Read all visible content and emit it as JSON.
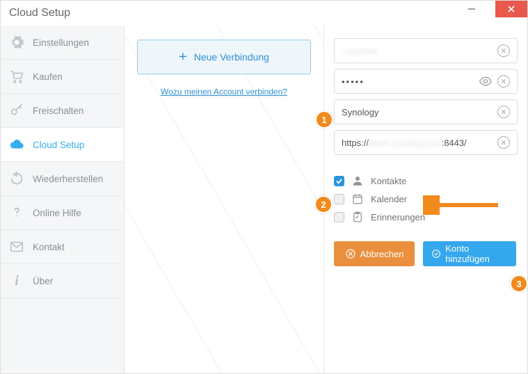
{
  "window": {
    "title": "Cloud Setup"
  },
  "sidebar": {
    "items": [
      {
        "id": "settings",
        "label": "Einstellungen"
      },
      {
        "id": "buy",
        "label": "Kaufen"
      },
      {
        "id": "unlock",
        "label": "Freischalten"
      },
      {
        "id": "cloud",
        "label": "Cloud Setup",
        "active": true
      },
      {
        "id": "restore",
        "label": "Wiederherstellen"
      },
      {
        "id": "help",
        "label": "Online Hilfe"
      },
      {
        "id": "contact",
        "label": "Kontakt"
      },
      {
        "id": "about",
        "label": "Über"
      }
    ]
  },
  "middle": {
    "new_connection_label": "Neue Verbindung",
    "why_link": "Wozu meinen Account verbinden?"
  },
  "form": {
    "username_obscured": "copykate",
    "password_value": "•••••",
    "servicename": "Synology",
    "url_prefix": "https://",
    "url_host_obscured": "beeft.synology.me",
    "url_suffix": ":8443/"
  },
  "sync": {
    "contacts": "Kontakte",
    "calendar": "Kalender",
    "reminders": "Erinnerungen"
  },
  "buttons": {
    "cancel": "Abbrechen",
    "add": "Konto hinzufügen"
  },
  "markers": {
    "m1": "1",
    "m2": "2",
    "m3": "3"
  }
}
